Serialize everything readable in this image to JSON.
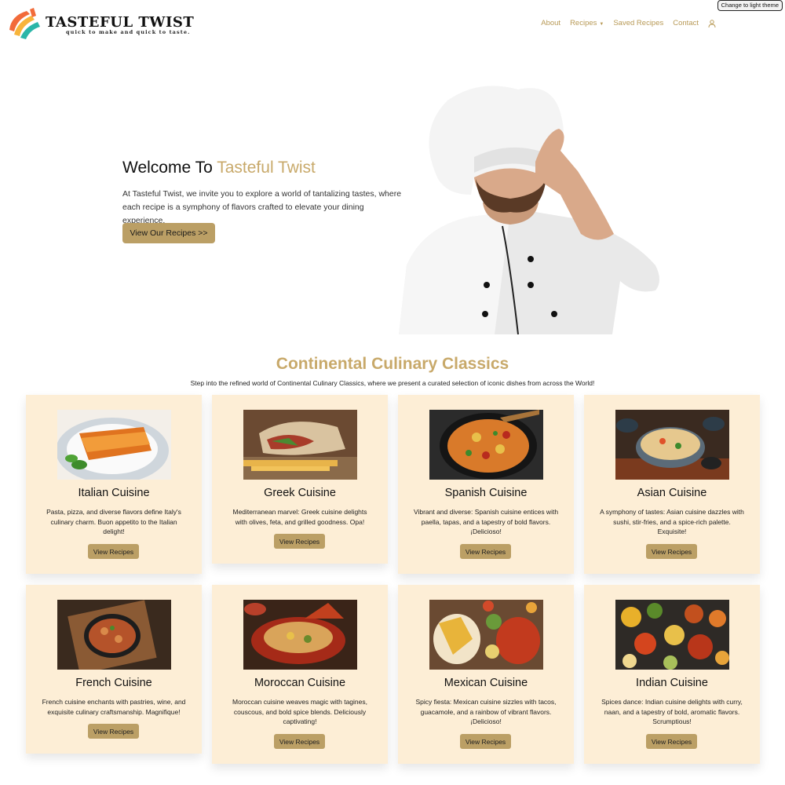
{
  "header": {
    "brand": "TASTEFUL TWIST",
    "tagline": "quick to make and quick to taste.",
    "theme_toggle": "Change to light theme",
    "nav": {
      "about": "About",
      "recipes": "Recipes",
      "saved": "Saved Recipes",
      "contact": "Contact",
      "user_icon": "user-icon"
    }
  },
  "hero": {
    "title_prefix": "Welcome To ",
    "title_accent": "Tasteful Twist",
    "description": "At Tasteful Twist, we invite you to explore a world of tantalizing tastes, where each recipe is a symphony of flavors crafted to elevate your dining experience.",
    "button": "View Our Recipes >>"
  },
  "section": {
    "title": "Continental Culinary Classics",
    "subtitle": "Step into the refined world of Continental Culinary Classics, where we present a curated selection of iconic dishes from across the World!"
  },
  "cards": [
    {
      "title": "Italian Cuisine",
      "description": "Pasta, pizza, and diverse flavors define Italy's culinary charm. Buon appetito to the Italian delight!",
      "button": "View Recipes"
    },
    {
      "title": "Greek Cuisine",
      "description": "Mediterranean marvel: Greek cuisine delights with olives, feta, and grilled goodness. Opa!",
      "button": "View Recipes"
    },
    {
      "title": "Spanish Cuisine",
      "description": "Vibrant and diverse: Spanish cuisine entices with paella, tapas, and a tapestry of bold flavors. ¡Delicioso!",
      "button": "View Recipes"
    },
    {
      "title": "Asian Cuisine",
      "description": "A symphony of tastes: Asian cuisine dazzles with sushi, stir-fries, and a spice-rich palette. Exquisite!",
      "button": "View Recipes"
    },
    {
      "title": "French Cuisine",
      "description": "French cuisine enchants with pastries, wine, and exquisite culinary craftsmanship. Magnifique!",
      "button": "View Recipes"
    },
    {
      "title": "Moroccan Cuisine",
      "description": "Moroccan cuisine weaves magic with tagines, couscous, and bold spice blends. Deliciously captivating!",
      "button": "View Recipes"
    },
    {
      "title": "Mexican Cuisine",
      "description": "Spicy fiesta: Mexican cuisine sizzles with tacos, guacamole, and a rainbow of vibrant flavors. ¡Delicioso!",
      "button": "View Recipes"
    },
    {
      "title": "Indian Cuisine",
      "description": "Spices dance: Indian cuisine delights with curry, naan, and a tapestry of bold, aromatic flavors. Scrumptious!",
      "button": "View Recipes"
    }
  ],
  "colors": {
    "accent": "#c8a96a",
    "button": "#bb9f65",
    "card_bg": "#fdeed6",
    "nav_text": "#b89a57"
  }
}
